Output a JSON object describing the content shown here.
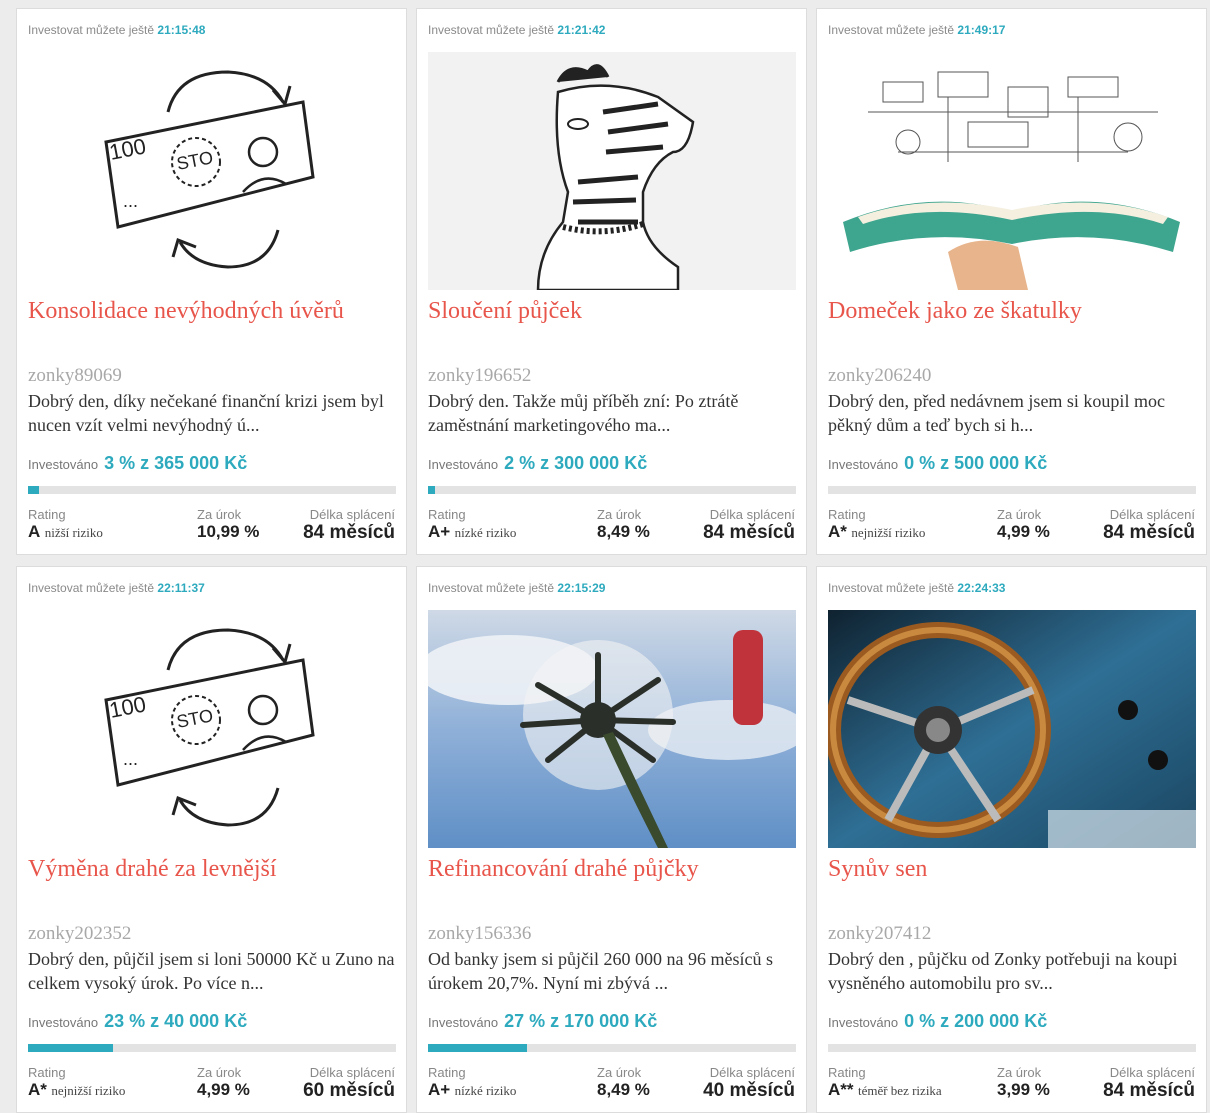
{
  "common": {
    "timer_label": "Investovat můžete ještě",
    "invested_label": "Investováno",
    "rating_label": "Rating",
    "rate_label": "Za úrok",
    "term_label": "Délka splácení"
  },
  "loans": [
    {
      "timer": "21:15:48",
      "image": "banknote-sketch",
      "title": "Konsolidace nevýhodných úvěrů",
      "user": "zonky89069",
      "story": "Dobrý den, díky nečekané finanční krizi jsem byl nucen vzít velmi nevýhodný ú...",
      "invested": "3 % z 365 000 Kč",
      "progress": 0.03,
      "grade": "A",
      "risk": "nižší riziko",
      "rate": "10,99 %",
      "term": "84 měsíců"
    },
    {
      "timer": "21:21:42",
      "image": "zebra-sketch",
      "title": "Sloučení půjček",
      "user": "zonky196652",
      "story": "Dobrý den. Takže můj příběh zní: Po ztrátě zaměstnání marketingového ma...",
      "invested": "2 % z 300 000 Kč",
      "progress": 0.02,
      "grade": "A+",
      "risk": "nízké riziko",
      "rate": "8,49 %",
      "term": "84 měsíců"
    },
    {
      "timer": "21:49:17",
      "image": "open-book-photo",
      "title": "Domeček jako ze škatulky",
      "user": "zonky206240",
      "story": "Dobrý den, před nedávnem jsem si koupil moc pěkný dům a teď bych si h...",
      "invested": "0 % z 500 000 Kč",
      "progress": 0,
      "grade": "A*",
      "risk": "nejnižší riziko",
      "rate": "4,99 %",
      "term": "84 měsíců"
    },
    {
      "timer": "22:11:37",
      "image": "banknote-sketch",
      "title": "Výměna drahé za levnější",
      "user": "zonky202352",
      "story": "Dobrý den, půjčil jsem si loni 50000 Kč u Zuno na celkem vysoký úrok. Po více n...",
      "invested": "23 % z 40 000 Kč",
      "progress": 0.23,
      "grade": "A*",
      "risk": "nejnižší riziko",
      "rate": "4,99 %",
      "term": "60 měsíců"
    },
    {
      "timer": "22:15:29",
      "image": "dandelion-photo",
      "title": "Refinancování drahé půjčky",
      "user": "zonky156336",
      "story": "Od banky jsem si půjčil 260 000 na 96 měsíců s úrokem 20,7%. Nyní mi zbývá ...",
      "invested": "27 % z 170 000 Kč",
      "progress": 0.27,
      "grade": "A+",
      "risk": "nízké riziko",
      "rate": "8,49 %",
      "term": "40 měsíců"
    },
    {
      "timer": "22:24:33",
      "image": "steering-wheel-photo",
      "title": "Synův sen",
      "user": "zonky207412",
      "story": "Dobrý den , půjčku od Zonky potřebuji na koupi vysněného automobilu pro sv...",
      "invested": "0 % z 200 000 Kč",
      "progress": 0,
      "grade": "A**",
      "risk": "téměř bez rizika",
      "rate": "3,99 %",
      "term": "84 měsíců"
    }
  ]
}
